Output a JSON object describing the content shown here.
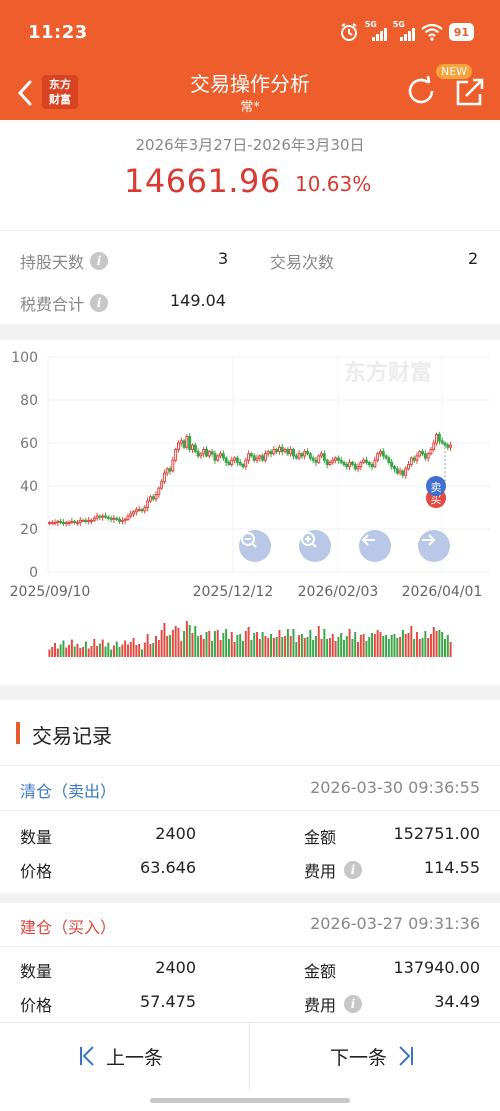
{
  "status_bar": {
    "time": "11:23",
    "network1": "5G",
    "network2": "5G",
    "battery": "91"
  },
  "nav": {
    "title": "交易操作分析",
    "subtitle": "常*",
    "logo_line1": "东方",
    "logo_line2": "财富",
    "badge": "NEW"
  },
  "summary": {
    "date_range": "2026年3月27日-2026年3月30日",
    "profit": "14661.96",
    "profit_pct": "10.63%"
  },
  "stats": {
    "hold_days_label": "持股天数",
    "hold_days": "3",
    "trade_count_label": "交易次数",
    "trade_count": "2",
    "fee_label": "税费合计",
    "fee_total": "149.04"
  },
  "chart_data": {
    "type": "candlestick",
    "watermark": "东方财富",
    "y_ticks": [
      "100",
      "80",
      "60",
      "40",
      "20",
      "0"
    ],
    "ylim": [
      0,
      100
    ],
    "x_ticks": [
      "2025/09/10",
      "2025/12/12",
      "2026/02/03",
      "2026/04/01"
    ],
    "x_range": [
      "2025/09/10",
      "2026/04/01"
    ],
    "markers": {
      "sell": "卖",
      "buy": "买"
    },
    "colors": {
      "up": "#e24a42",
      "down": "#3aa64a",
      "sell_marker": "#3f6fd0",
      "buy_marker": "#e24a42"
    },
    "close_series": [
      23,
      23,
      23,
      23.5,
      23,
      22.5,
      23,
      23,
      23.5,
      23,
      23,
      24,
      24,
      23.5,
      24,
      24,
      25,
      26,
      25.5,
      26,
      25.5,
      25,
      24.5,
      25,
      24.5,
      23.5,
      24,
      24.5,
      26,
      27,
      28,
      29,
      29,
      28.5,
      30,
      33,
      35,
      34,
      36,
      39,
      42,
      46,
      48,
      47,
      52,
      57,
      60,
      61,
      58,
      63,
      57,
      59,
      56,
      54,
      55,
      57,
      54,
      56,
      55,
      52,
      54,
      55,
      53,
      51,
      50,
      52,
      53,
      51,
      50,
      49,
      52,
      55,
      54,
      52,
      53,
      54,
      52,
      55,
      56,
      55,
      57,
      56,
      58,
      56,
      57,
      55,
      57,
      54,
      53,
      55,
      54,
      56,
      55,
      53,
      52,
      51,
      54,
      55,
      52,
      50,
      51,
      52,
      53,
      52,
      51,
      50,
      49,
      51,
      50,
      48,
      49,
      51,
      52,
      51,
      50,
      49,
      52,
      55,
      56,
      54,
      53,
      51,
      49,
      48,
      46,
      47,
      45,
      48,
      50,
      53,
      52,
      54,
      56,
      55,
      53,
      55,
      57,
      60,
      64,
      61,
      60,
      59,
      58,
      59
    ]
  },
  "chart_controls": {
    "zoom_out": "zoom-out",
    "zoom_in": "zoom-in",
    "prev": "prev",
    "next": "next"
  },
  "records": {
    "title": "交易记录",
    "items": [
      {
        "kind": "清仓（卖出）",
        "color": "#3a78c6",
        "time": "2026-03-30 09:36:55",
        "qty_label": "数量",
        "qty": "2400",
        "amount_label": "金额",
        "amount": "152751.00",
        "price_label": "价格",
        "price": "63.646",
        "fee_label": "费用",
        "fee": "114.55"
      },
      {
        "kind": "建仓（买入）",
        "color": "#e0483f",
        "time": "2026-03-27 09:31:36",
        "qty_label": "数量",
        "qty": "2400",
        "amount_label": "金额",
        "amount": "137940.00",
        "price_label": "价格",
        "price": "57.475",
        "fee_label": "费用",
        "fee": "34.49"
      }
    ]
  },
  "bottom": {
    "prev": "上一条",
    "next": "下一条"
  }
}
